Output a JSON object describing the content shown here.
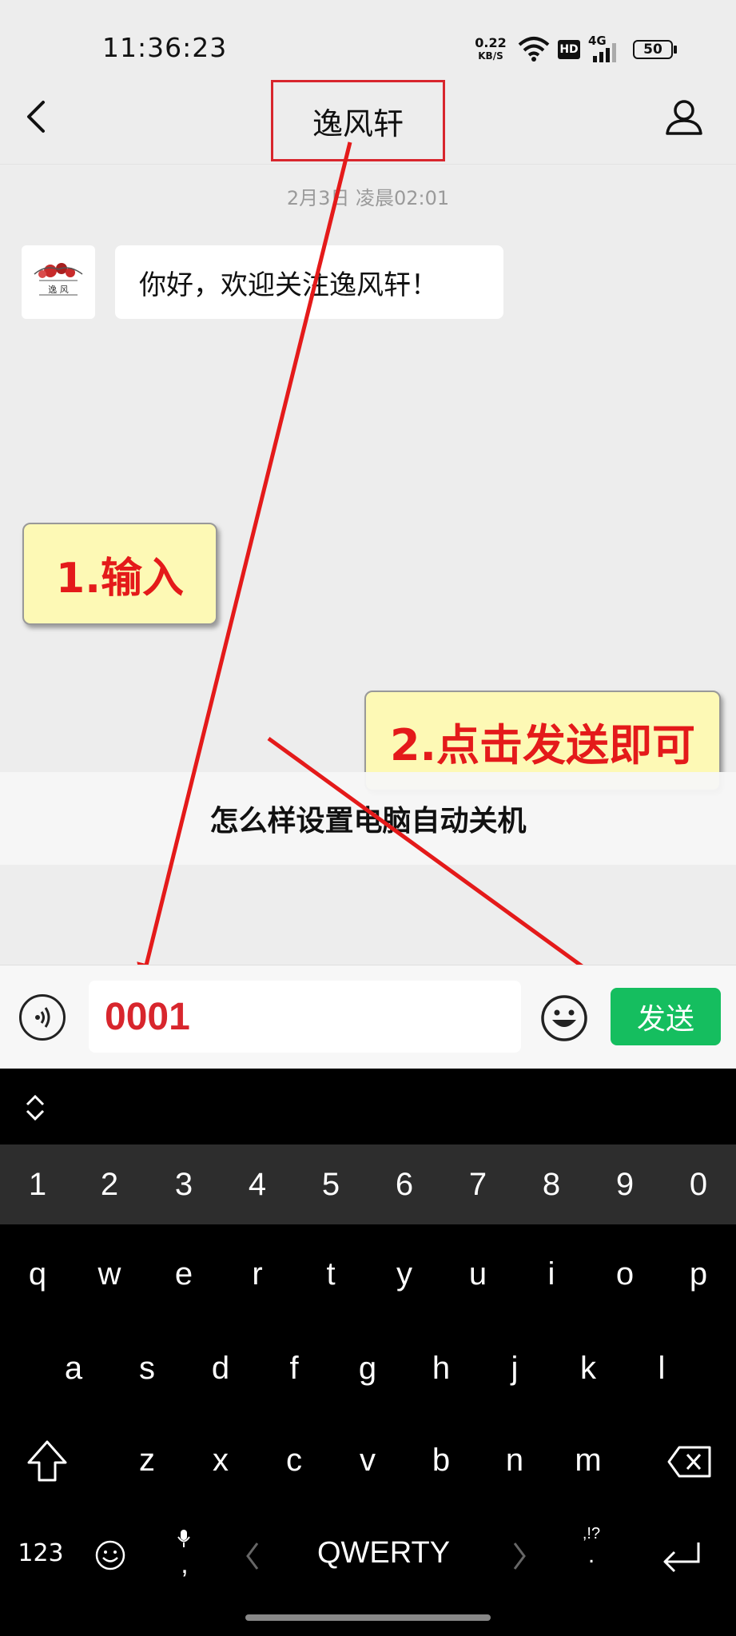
{
  "status_bar": {
    "time": "11:36:23",
    "net_speed_value": "0.22",
    "net_speed_unit": "KB/S",
    "hd_badge": "HD",
    "network": "4G",
    "battery": "50",
    "icons": [
      "wifi-icon",
      "signal-icon",
      "battery-icon"
    ]
  },
  "header": {
    "title": "逸风轩",
    "icons": [
      "back-icon",
      "profile-icon"
    ]
  },
  "chat": {
    "timestamp": "2月3日 凌晨02:01",
    "messages": [
      {
        "sender": "逸风轩",
        "text": "你好，欢迎关注逸风轩！"
      }
    ],
    "avatar_text": "逸 风"
  },
  "annotations": {
    "step1": "1.输入",
    "step2": "2.点击发送即可",
    "arrow_color": "#e41a1a"
  },
  "banner": {
    "text": "怎么样设置电脑自动关机"
  },
  "composer": {
    "input_value": "0001",
    "send_label": "发送",
    "send_color": "#15be5f",
    "icons": [
      "voice-icon",
      "emoji-icon"
    ]
  },
  "keyboard": {
    "number_row": [
      "1",
      "2",
      "3",
      "4",
      "5",
      "6",
      "7",
      "8",
      "9",
      "0"
    ],
    "row1": [
      "q",
      "w",
      "e",
      "r",
      "t",
      "y",
      "u",
      "i",
      "o",
      "p"
    ],
    "row2": [
      "a",
      "s",
      "d",
      "f",
      "g",
      "h",
      "j",
      "k",
      "l"
    ],
    "row3": [
      "z",
      "x",
      "c",
      "v",
      "b",
      "n",
      "m"
    ],
    "bottom": {
      "mode_label": "123",
      "comma": ",",
      "space_label": "QWERTY",
      "punct_top": ",!?",
      "punct_bottom": "."
    },
    "icons": [
      "expand-collapse-icon",
      "shift-icon",
      "backspace-icon",
      "emoji-icon",
      "mic-icon",
      "enter-icon"
    ]
  }
}
